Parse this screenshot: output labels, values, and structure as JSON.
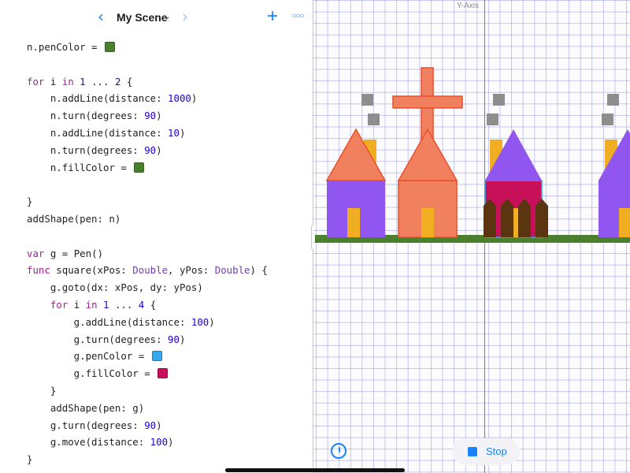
{
  "nav": {
    "title": "My Scene",
    "back_icon": "chevron-left-icon",
    "forward_icon": "chevron-right-icon",
    "dropdown_icon": "chevron-down-icon",
    "add_icon": "plus-icon",
    "more_icon": "ellipsis-icon"
  },
  "code_lines": [
    [
      {
        "t": "n.penColor = "
      },
      {
        "swatch": "#4a7f2e"
      }
    ],
    [],
    [
      {
        "t": "for",
        "c": "kw"
      },
      {
        "t": " i "
      },
      {
        "t": "in",
        "c": "kw"
      },
      {
        "t": " "
      },
      {
        "t": "1",
        "c": "num"
      },
      {
        "t": " ... "
      },
      {
        "t": "2",
        "c": "num"
      },
      {
        "t": " {"
      }
    ],
    [
      {
        "t": "    n.addLine(distance: "
      },
      {
        "t": "1000",
        "c": "num"
      },
      {
        "t": ")"
      }
    ],
    [
      {
        "t": "    n.turn(degrees: "
      },
      {
        "t": "90",
        "c": "num"
      },
      {
        "t": ")"
      }
    ],
    [
      {
        "t": "    n.addLine(distance: "
      },
      {
        "t": "10",
        "c": "num"
      },
      {
        "t": ")"
      }
    ],
    [
      {
        "t": "    n.turn(degrees: "
      },
      {
        "t": "90",
        "c": "num"
      },
      {
        "t": ")"
      }
    ],
    [
      {
        "t": "    n.fillColor = "
      },
      {
        "swatch": "#4a7f2e"
      }
    ],
    [],
    [
      {
        "t": "}"
      }
    ],
    [
      {
        "t": "addShape(pen: n)"
      }
    ],
    [],
    [
      {
        "t": "var",
        "c": "kw"
      },
      {
        "t": " g = Pen()"
      }
    ],
    [
      {
        "t": "func",
        "c": "kw"
      },
      {
        "t": " square(xPos: "
      },
      {
        "t": "Double",
        "c": "typ"
      },
      {
        "t": ", yPos: "
      },
      {
        "t": "Double",
        "c": "typ"
      },
      {
        "t": ") {"
      }
    ],
    [
      {
        "t": "    g.goto(dx: xPos, dy: yPos)"
      }
    ],
    [
      {
        "t": "    "
      },
      {
        "t": "for",
        "c": "kw"
      },
      {
        "t": " i "
      },
      {
        "t": "in",
        "c": "kw"
      },
      {
        "t": " "
      },
      {
        "t": "1",
        "c": "num"
      },
      {
        "t": " ... "
      },
      {
        "t": "4",
        "c": "num"
      },
      {
        "t": " {"
      }
    ],
    [
      {
        "t": "        g.addLine(distance: "
      },
      {
        "t": "100",
        "c": "num"
      },
      {
        "t": ")"
      }
    ],
    [
      {
        "t": "        g.turn(degrees: "
      },
      {
        "t": "90",
        "c": "num"
      },
      {
        "t": ")"
      }
    ],
    [
      {
        "t": "        g.penColor = "
      },
      {
        "swatch": "#35a8ee"
      }
    ],
    [
      {
        "t": "        g.fillColor = "
      },
      {
        "swatch": "#c8105a"
      }
    ],
    [
      {
        "t": "    }"
      }
    ],
    [
      {
        "t": "    addShape(pen: g)"
      }
    ],
    [
      {
        "t": "    g.turn(degrees: "
      },
      {
        "t": "90",
        "c": "num"
      },
      {
        "t": ")"
      }
    ],
    [
      {
        "t": "    g.move(distance: "
      },
      {
        "t": "100",
        "c": "num"
      },
      {
        "t": ")"
      }
    ],
    [
      {
        "t": "}"
      }
    ]
  ],
  "canvas": {
    "axis_label": "Y-Axis",
    "colors": {
      "purple": "#9155f0",
      "orange": "#f0805e",
      "orange_stroke": "#e8502a",
      "yellow": "#f2ae22",
      "green": "#4a7f2e",
      "crimson": "#c8105a",
      "blue_stroke": "#35a8ee",
      "brown": "#5a3510",
      "gray": "#8e8e8e"
    }
  },
  "controls": {
    "speed_icon": "speedometer-icon",
    "stop_icon": "stop-icon",
    "stop_label": "Stop"
  }
}
